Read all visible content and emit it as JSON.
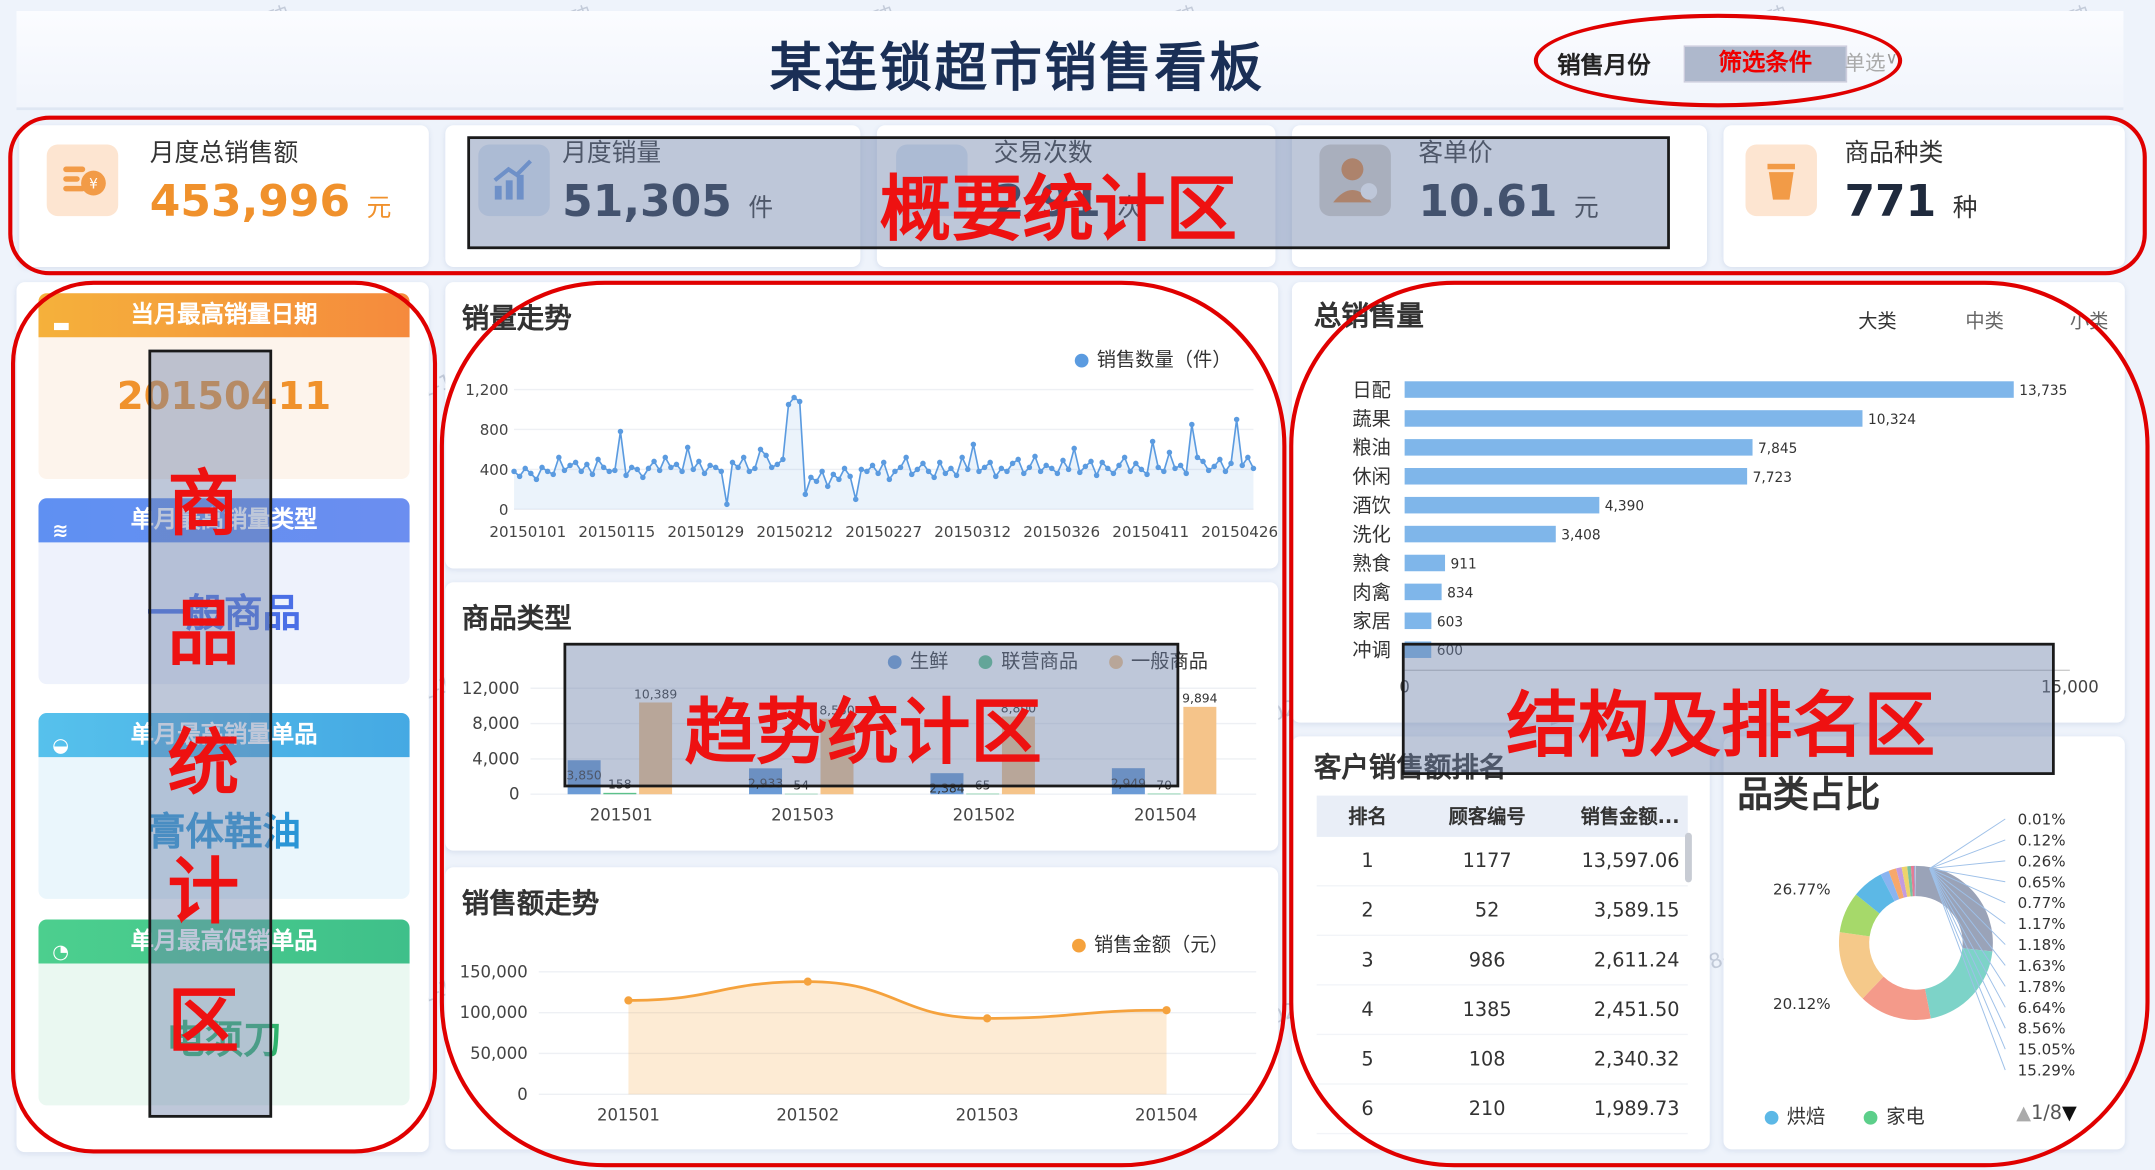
{
  "title": "某连锁超市销售看板",
  "filter": {
    "label": "销售月份",
    "tag": "筛选条件",
    "placeholder": "单选",
    "chevron": "∨"
  },
  "kpis": [
    {
      "label": "月度总销售额",
      "value": "453,996",
      "unit": "元"
    },
    {
      "label": "月度销量",
      "value": "51,305",
      "unit": "件"
    },
    {
      "label": "交易次数",
      "value": "2  91",
      "unit": "次"
    },
    {
      "label": "客单价",
      "value": "10.61",
      "unit": "元"
    },
    {
      "label": "商品种类",
      "value": "771",
      "unit": "种"
    }
  ],
  "side_cards": [
    {
      "title": "当月最高销量日期",
      "value": "20150411",
      "color": "#f5a13d"
    },
    {
      "title": "单月最高销量类型",
      "value": "一般商品",
      "color": "#5a8cf0"
    },
    {
      "title": "单月最高销量单品",
      "value": "膏体鞋油",
      "color": "#4fb3e6"
    },
    {
      "title": "单月最高促销单品",
      "value": "电须刀",
      "color": "#49c98b"
    }
  ],
  "panels": {
    "trend": "销量走势",
    "category": "商品类型",
    "sales_trend": "销售额走势",
    "total": "总销售量",
    "rank": "客户销售额排名",
    "share": "品类占比"
  },
  "level_tabs": [
    "大类",
    "中类",
    "小类"
  ],
  "overlays": {
    "summary": "概要统计区",
    "trend": "趋势统计区",
    "structure": "结构及排名区",
    "left": [
      "商",
      "品",
      "统",
      "计",
      "区"
    ]
  },
  "watermark": "2024-01-19 10:58-彭一珅",
  "rank_table": {
    "headers": [
      "排名",
      "顾客编号",
      "销售金额..."
    ],
    "rows": [
      [
        "1",
        "1177",
        "13,597.06"
      ],
      [
        "2",
        "52",
        "3,589.15"
      ],
      [
        "3",
        "986",
        "2,611.24"
      ],
      [
        "4",
        "1385",
        "2,451.50"
      ],
      [
        "5",
        "108",
        "2,340.32"
      ],
      [
        "6",
        "210",
        "1,989.73"
      ]
    ]
  },
  "pie_legend": {
    "items": [
      "烘焙",
      "家电"
    ],
    "pager": "1/8",
    "up": "▲",
    "down": "▼"
  },
  "chart_data": [
    {
      "type": "line",
      "title": "销量走势",
      "series_name": "销售数量（件）",
      "x_ticks": [
        "20150101",
        "20150115",
        "20150129",
        "20150212",
        "20150227",
        "20150312",
        "20150326",
        "20150411",
        "20150426"
      ],
      "ylim": [
        0,
        1200
      ],
      "y_ticks": [
        "0",
        "400",
        "800",
        "1,200"
      ],
      "values": [
        380,
        330,
        410,
        360,
        300,
        420,
        380,
        350,
        520,
        390,
        440,
        470,
        380,
        450,
        350,
        500,
        420,
        380,
        390,
        780,
        340,
        420,
        400,
        320,
        410,
        480,
        390,
        520,
        420,
        450,
        380,
        620,
        400,
        480,
        360,
        440,
        420,
        380,
        50,
        470,
        420,
        520,
        380,
        410,
        600,
        540,
        420,
        450,
        500,
        1050,
        1120,
        1080,
        150,
        320,
        280,
        380,
        230,
        350,
        300,
        410,
        330,
        100,
        400,
        380,
        440,
        360,
        470,
        300,
        380,
        420,
        520,
        350,
        400,
        460,
        380,
        320,
        470,
        360,
        410,
        340,
        520,
        400,
        650,
        380,
        420,
        470,
        330,
        410,
        380,
        460,
        500,
        360,
        420,
        530,
        380,
        440,
        410,
        360,
        490,
        400,
        610,
        370,
        430,
        480,
        340,
        470,
        410,
        360,
        440,
        520,
        380,
        460,
        400,
        350,
        680,
        420,
        380,
        570,
        410,
        440,
        360,
        850,
        520,
        480,
        390,
        430,
        500,
        380,
        460,
        900,
        440,
        520,
        410
      ]
    },
    {
      "type": "bar",
      "title": "商品类型",
      "categories": [
        "201501",
        "201503",
        "201502",
        "201504"
      ],
      "series": [
        {
          "name": "生鲜",
          "values": [
            3850,
            2933,
            2384,
            2949
          ],
          "color": "#6b9bd6"
        },
        {
          "name": "联营商品",
          "values": [
            158,
            54,
            65,
            70
          ],
          "color": "#5cc18a"
        },
        {
          "name": "一般商品",
          "values": [
            10389,
            8550,
            8800,
            9894
          ],
          "color": "#f5c48a"
        }
      ],
      "ylim": [
        0,
        12000
      ],
      "y_ticks": [
        "0",
        "4,000",
        "8,000",
        "12,000"
      ]
    },
    {
      "type": "area",
      "title": "销售额走势",
      "series_name": "销售金额（元）",
      "categories": [
        "201501",
        "201502",
        "201503",
        "201504"
      ],
      "values": [
        115000,
        138000,
        93000,
        103000
      ],
      "ylim": [
        0,
        150000
      ],
      "y_ticks": [
        "0",
        "50,000",
        "100,000",
        "150,000"
      ]
    },
    {
      "type": "bar",
      "orientation": "horizontal",
      "title": "总销售量",
      "categories": [
        "日配",
        "蔬果",
        "粮油",
        "休闲",
        "酒饮",
        "洗化",
        "熟食",
        "肉禽",
        "家居",
        "冲调"
      ],
      "values": [
        13735,
        10324,
        7845,
        7723,
        4390,
        3408,
        911,
        834,
        603,
        600
      ],
      "value_labels": [
        "13,735",
        "10,324",
        "7,845",
        "7,723",
        "4,390",
        "3,408",
        "911",
        "834",
        "603",
        "600"
      ],
      "xlim": [
        0,
        15000
      ],
      "x_ticks": [
        "0",
        "15,000"
      ]
    },
    {
      "type": "pie",
      "title": "品类占比",
      "labels_left": [
        "26.77%",
        "20.12%"
      ],
      "labels_right": [
        "0.01%",
        "0.12%",
        "0.26%",
        "0.65%",
        "0.77%",
        "1.17%",
        "1.18%",
        "1.63%",
        "1.78%",
        "6.64%",
        "8.56%",
        "15.05%",
        "15.29%"
      ],
      "values": [
        26.77,
        20.12,
        15.29,
        15.05,
        8.56,
        6.64,
        1.78,
        1.63,
        1.18,
        1.17,
        0.77,
        0.65,
        0.26,
        0.12,
        0.01
      ],
      "colors": [
        "#9aa3b8",
        "#7dd3c8",
        "#f49a8a",
        "#f5c98a",
        "#a6d96a",
        "#5cb8e6",
        "#8ab4f0",
        "#f7a86b",
        "#c49bde",
        "#eed36b",
        "#78c2a0",
        "#e57c96",
        "#8fa3d9",
        "#c7c7c7",
        "#6c84c4"
      ]
    }
  ]
}
